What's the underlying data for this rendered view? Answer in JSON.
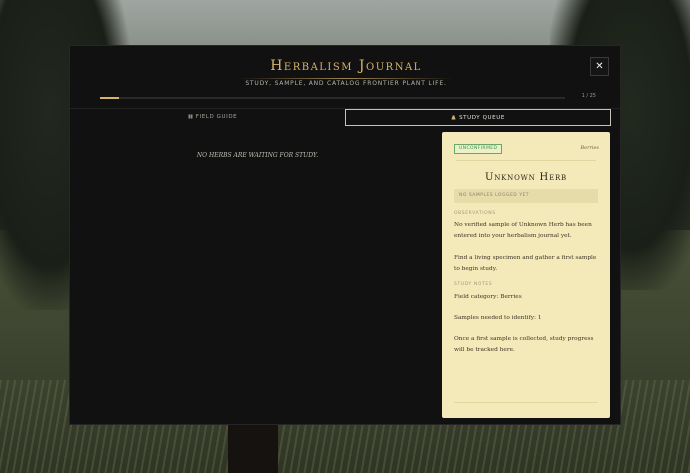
{
  "journal": {
    "title": "Herbalism Journal",
    "subtitle": "STUDY, SAMPLE, AND CATALOG FRONTIER PLANT LIFE.",
    "close_label": "✕",
    "progress": {
      "text": "1 / 25",
      "fraction": 0.04
    }
  },
  "tabs": [
    {
      "label": "FIELD GUIDE",
      "icon": "book-icon",
      "active": false
    },
    {
      "label": "STUDY QUEUE",
      "icon": "flask-icon",
      "active": true
    }
  ],
  "queue": {
    "empty_message": "NO HERBS ARE WAITING FOR STUDY."
  },
  "detail": {
    "status_badge": "UNCONFIRMED",
    "category": "Berries",
    "name": "Unknown Herb",
    "samples_status": "NO SAMPLES LOGGED YET",
    "observations_label": "OBSERVATIONS",
    "observations": [
      "No verified sample of Unknown Herb has been entered into your herbalism journal yet.",
      "Find a living specimen and gather a first sample to begin study."
    ],
    "notes_label": "STUDY NOTES",
    "notes": [
      "Field category: Berries",
      "Samples needed to identify: 1",
      "Once a first sample is collected, study progress will be tracked here."
    ]
  },
  "colors": {
    "accent_gold": "#d6b46a",
    "card_bg": "#f4eab9",
    "badge_green": "#4d8f4d",
    "modal_bg": "#111111"
  }
}
